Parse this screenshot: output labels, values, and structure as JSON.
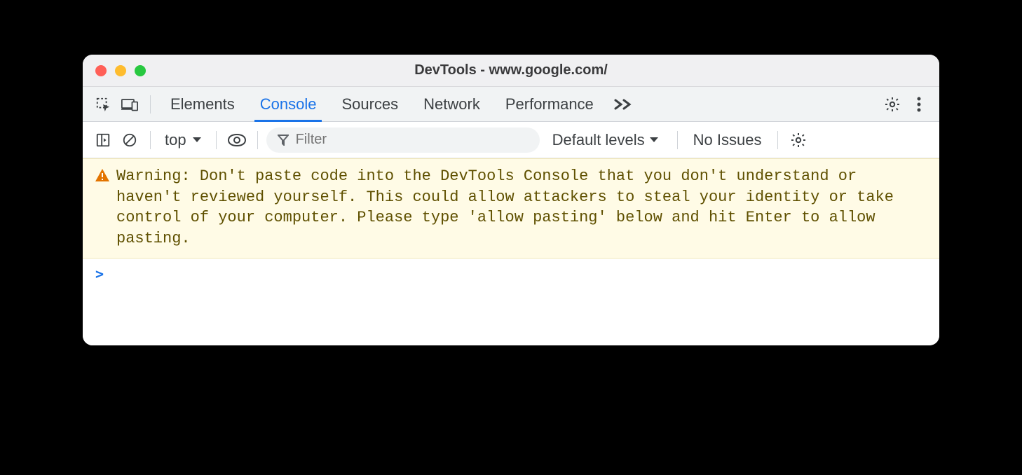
{
  "window": {
    "title": "DevTools - www.google.com/"
  },
  "tabs": {
    "elements": "Elements",
    "console": "Console",
    "sources": "Sources",
    "network": "Network",
    "performance": "Performance"
  },
  "toolbar": {
    "context": "top",
    "filter_placeholder": "Filter",
    "levels": "Default levels",
    "issues": "No Issues"
  },
  "console": {
    "warning_text": "Warning: Don't paste code into the DevTools Console that you don't understand or haven't reviewed yourself. This could allow attackers to steal your identity or take control of your computer. Please type 'allow pasting' below and hit Enter to allow pasting.",
    "prompt": ">"
  }
}
